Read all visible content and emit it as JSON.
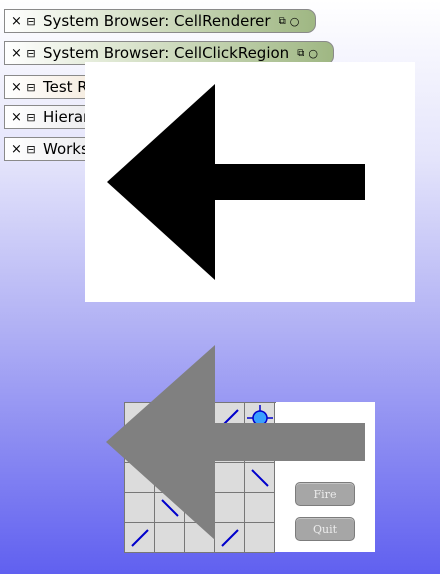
{
  "tabs": [
    {
      "close": "×",
      "menu": "⊟",
      "title": "System Browser: CellRenderer",
      "collapse": "⧉",
      "expand": "○"
    },
    {
      "close": "×",
      "menu": "⊟",
      "title": "System Browser: CellClickRegion",
      "collapse": "⧉",
      "expand": "○"
    },
    {
      "close": "×",
      "menu": "⊟",
      "title": "Test Runner"
    },
    {
      "close": "×",
      "menu": "⊟",
      "title": "Hierarchy Browser"
    },
    {
      "close": "×",
      "menu": "⊟",
      "title": "Workspace"
    }
  ],
  "arrow_color": "#000000",
  "overlay_arrow_color": "#808080",
  "game": {
    "cells": [
      "empty",
      "empty",
      "empty",
      "line-slash",
      "target",
      "empty",
      "empty",
      "empty",
      "empty",
      "empty",
      "empty",
      "empty",
      "empty",
      "empty",
      "line-backslash",
      "empty",
      "line-backslash",
      "empty",
      "empty",
      "empty",
      "line-slash",
      "empty",
      "empty",
      "line-slash",
      "empty"
    ],
    "line_color": "#0000cc",
    "fire_label": "Fire",
    "quit_label": "Quit"
  }
}
